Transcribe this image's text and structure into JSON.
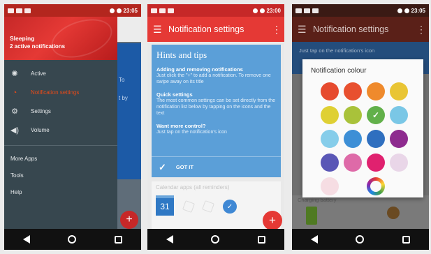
{
  "phone1": {
    "time": "23:05",
    "drawer": {
      "status_title": "Sleeping",
      "status_sub": "2 active notifications",
      "items": [
        {
          "label": "Active",
          "icon": "sun-icon"
        },
        {
          "label": "Notification settings",
          "icon": "alert-icon"
        },
        {
          "label": "Settings",
          "icon": "gear-icon"
        },
        {
          "label": "Volume",
          "icon": "speaker-icon"
        }
      ],
      "more_apps": "More Apps",
      "tools": "Tools",
      "help": "Help"
    },
    "bg_text": [
      "To",
      "t by"
    ],
    "fab": "+"
  },
  "phone2": {
    "time": "23:00",
    "title": "Notification settings",
    "tips": {
      "title": "Hints and tips",
      "h1": "Adding and removing notifications",
      "b1": "Just click the \"+\" to add a notification. To remove one swipe away on its title",
      "h2": "Quick settings",
      "b2": "The most common settings can be set directly from the notification list below by tapping on the icons and the text",
      "h3": "Want more control?",
      "b3": "Just tap on the notification's icon",
      "got_it": "GOT IT"
    },
    "calendar": {
      "label": "Calendar apps (all reminders)",
      "day": "31"
    },
    "fab": "+"
  },
  "phone3": {
    "time": "23:05",
    "title": "Notification settings",
    "blue_text": "Just tap on the notification's icon",
    "charging_label": "Charging battery",
    "dialog": {
      "title": "Notification colour",
      "swatches": [
        {
          "color": "#e64a2e",
          "checked": false
        },
        {
          "color": "#e8502f",
          "checked": false
        },
        {
          "color": "#ef8a2c",
          "checked": false
        },
        {
          "color": "#e9c534",
          "checked": false
        },
        {
          "color": "#dfd034",
          "checked": false
        },
        {
          "color": "#a9c23a",
          "checked": false
        },
        {
          "color": "#62b04a",
          "checked": true
        },
        {
          "color": "#7ac7e6",
          "checked": false
        },
        {
          "color": "#86cdea",
          "checked": false
        },
        {
          "color": "#3d8fd6",
          "checked": false
        },
        {
          "color": "#2f6fbf",
          "checked": false
        },
        {
          "color": "#8e2b8f",
          "checked": false
        },
        {
          "color": "#5a57b6",
          "checked": false
        },
        {
          "color": "#de6aa8",
          "checked": false
        },
        {
          "color": "#e0216f",
          "checked": false
        },
        {
          "color": "#e9d6e8",
          "checked": false
        },
        {
          "color": "#f6dde3",
          "checked": false
        }
      ]
    }
  }
}
